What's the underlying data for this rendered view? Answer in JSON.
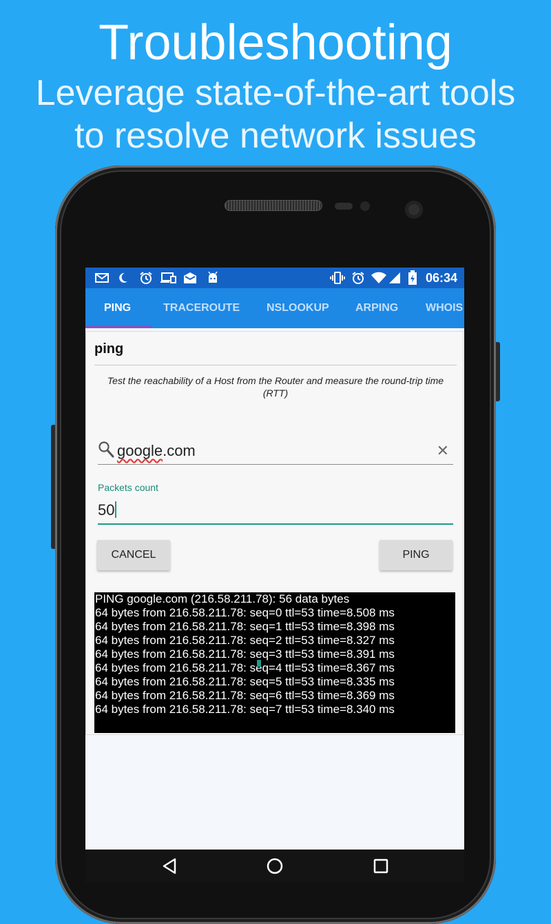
{
  "headline": {
    "title": "Troubleshooting",
    "line2": "Leverage state-of-the-art tools",
    "line3": "to resolve network issues"
  },
  "status_bar": {
    "time": "06:34",
    "icons": [
      "mail-icon",
      "moon-icon",
      "alarm-icon",
      "cast-icon",
      "inbox-icon",
      "android-icon",
      "vibrate-icon",
      "alarm-icon",
      "wifi-icon",
      "signal-icon",
      "battery-icon"
    ]
  },
  "tabs": [
    {
      "label": "PING",
      "active": true
    },
    {
      "label": "TRACEROUTE",
      "active": false
    },
    {
      "label": "NSLOOKUP",
      "active": false
    },
    {
      "label": "ARPING",
      "active": false
    },
    {
      "label": "WHOIS",
      "active": false
    }
  ],
  "card": {
    "title": "ping",
    "description": "Test the reachability of a Host from the Router and measure the round-trip time (RTT)"
  },
  "search": {
    "value_word": "google",
    "value_rest": ".com"
  },
  "packets": {
    "label": "Packets count",
    "value": "50"
  },
  "buttons": {
    "cancel": "CANCEL",
    "ping": "PING"
  },
  "console": {
    "lines": [
      "PING google.com (216.58.211.78): 56 data bytes",
      "64 bytes from 216.58.211.78: seq=0 ttl=53 time=8.508 ms",
      "64 bytes from 216.58.211.78: seq=1 ttl=53 time=8.398 ms",
      "64 bytes from 216.58.211.78: seq=2 ttl=53 time=8.327 ms",
      "64 bytes from 216.58.211.78: seq=3 ttl=53 time=8.391 ms",
      "64 bytes from 216.58.211.78: seq=4 ttl=53 time=8.367 ms",
      "64 bytes from 216.58.211.78: seq=5 ttl=53 time=8.335 ms",
      "64 bytes from 216.58.211.78: seq=6 ttl=53 time=8.369 ms",
      "64 bytes from 216.58.211.78: seq=7 ttl=53 time=8.340 ms"
    ]
  },
  "colors": {
    "background": "#27a8f4",
    "status_bar": "#1562c5",
    "tab_bar": "#1e88e5",
    "tab_indicator": "#7e57c2",
    "accent": "#1e9a88"
  }
}
